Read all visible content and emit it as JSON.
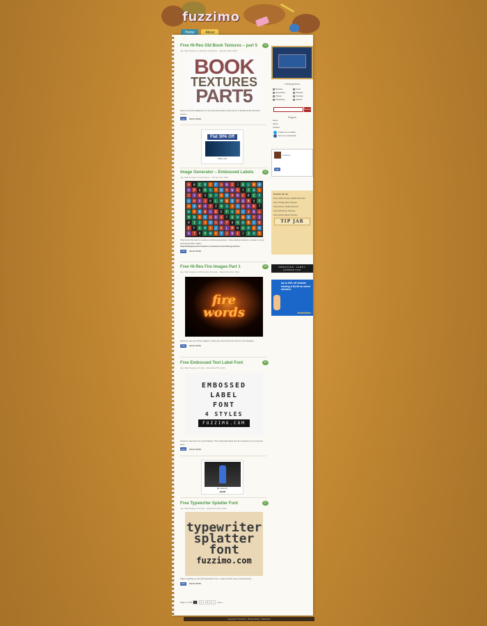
{
  "site": {
    "logo": "fuzzimo",
    "nav": [
      "Home",
      "About"
    ]
  },
  "posts": [
    {
      "title": "Free Hi-Res Old Book Textures – part 5",
      "meta": "Jay, Web Design on Textures & Patterns · January 10th, 2012",
      "comments": "13",
      "image_words": [
        "BOOK",
        "TEXTURES",
        "PART5"
      ],
      "excerpt": "Here is the 5th installment of my old book texture series and it is all about the old book covers...",
      "like": "Like",
      "read_more": "READ MORE"
    },
    {
      "title": "Image Generator – Embossed Labels",
      "meta": "Jay, Web Design on Generators · January 3rd, 2012",
      "comments": "19",
      "excerpt": "This is the first tool in a series of online generators. I have always wanted to create my own embossed label maker...",
      "link": "http://labelgenerator.fuzzimo.com/embossed-label-generator",
      "like": "Like",
      "read_more": "READ MORE"
    },
    {
      "title": "Free Hi-Res Fire Images Part 1",
      "meta": "Jay, Web Design on Photoshop Tutorials · December 21st, 2011",
      "comments": "32",
      "image_words": [
        "fire",
        "words"
      ],
      "excerpt": "Here's a new set of fire images in case you need some fire text for your designs...",
      "like": "Like",
      "read_more": "READ MORE"
    },
    {
      "title": "Free Embossed Text Label Font",
      "meta": "Jay, Web Design on Fonts · December 5th, 2011",
      "comments": "22",
      "image_words": [
        "EMBOSSED",
        "LABEL",
        "FONT",
        "4 STYLES",
        "FUZZIMO.COM"
      ],
      "excerpt": "Here's a new free font I just finished. The embossed label text font, based on my previous post...",
      "like": "Like",
      "read_more": "READ MORE"
    },
    {
      "title": "Free Typewriter Splatter Font",
      "meta": "Jay, Web Design on Fonts · November 22nd, 2011",
      "comments": "27",
      "image_words": [
        "typewriter",
        "splatter",
        "font",
        "fuzzimo.com"
      ],
      "excerpt": "When working on the Old Typewriter Font, I was left with some extra textures...",
      "like": "Like",
      "read_more": "READ MORE"
    }
  ],
  "ads": [
    {
      "headline": "Flat 30% Off",
      "sub": "Shop now"
    },
    {
      "headline": "$1 more for",
      "sub": ".com"
    }
  ],
  "pager": {
    "label": "Page 1 of 18",
    "pages": [
      "1",
      "2",
      "3",
      "»"
    ],
    "last": "Last »"
  },
  "sidebar": {
    "categories_title": "Categories",
    "categories": [
      "Brushes",
      "Fonts",
      "Generators",
      "Textures",
      "Photos",
      "Tutorials",
      "Photoshop",
      "Vectors"
    ],
    "search_button": "Search",
    "pages_title": "Pages",
    "pages": [
      "Home",
      "About",
      "Contact"
    ],
    "social": [
      "Follow me on twitter",
      "Like me on facebook"
    ],
    "facebook_name": "Fuzzimo",
    "facebook_like": "Like",
    "tip_header": "Fuzzimo Tip Jar",
    "tip_items": [
      "Free Hi-Res Flower Splatter Brushes",
      "Free Vintage Retro Frames",
      "Free Hi-Res Crinkle Textures",
      "Free Old Stucco Textures",
      "Free Hi-Res Paper Textures"
    ],
    "tip_jar": "TIP JAR",
    "label_generator": "EMBOSSED LABEL GENERATOR",
    "hostgator": {
      "headline": "Up to 60% off website hosting & $4.99 on select domains",
      "brand": "HostGator"
    }
  },
  "footer": "Copyright © Fuzzimo · Privacy Policy · Disclosure"
}
